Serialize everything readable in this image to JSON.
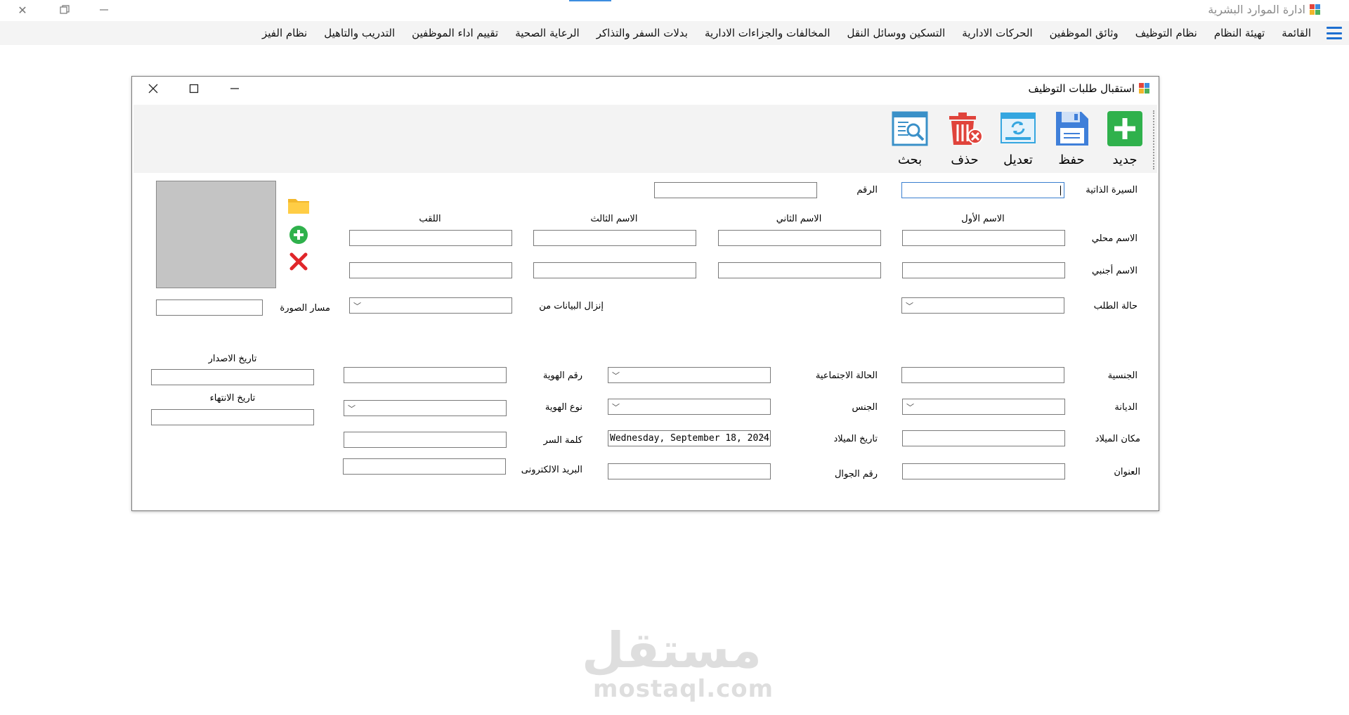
{
  "app": {
    "title": "ادارة الموارد البشرية",
    "accent_color": "#3c8de0"
  },
  "menu": {
    "icon": "hamburger-icon",
    "items": [
      {
        "label": "القائمة"
      },
      {
        "label": "تهيئة النظام"
      },
      {
        "label": "نظام التوظيف"
      },
      {
        "label": "وثائق الموظفين"
      },
      {
        "label": "الحركات الادارية"
      },
      {
        "label": "التسكين ووسائل النقل"
      },
      {
        "label": "المخالفات والجزاءات الادارية"
      },
      {
        "label": "بدلات السفر والتذاكر"
      },
      {
        "label": "الرعاية الصحية"
      },
      {
        "label": "تقييم اداء الموظفين"
      },
      {
        "label": "التدريب والتاهيل"
      },
      {
        "label": "نظام الفيز"
      }
    ]
  },
  "form": {
    "title": "استقبال طلبات التوظيف",
    "toolbar": {
      "new": {
        "label": "جديد",
        "icon": "add-icon",
        "color": "#2fb14c"
      },
      "save": {
        "label": "حفظ",
        "icon": "save-icon",
        "color": "#3f7fd9"
      },
      "edit": {
        "label": "تعديل",
        "icon": "refresh-edit-icon",
        "color": "#35a6e0"
      },
      "delete": {
        "label": "حذف",
        "icon": "trash-icon",
        "color": "#e0433b"
      },
      "search": {
        "label": "بحث",
        "icon": "search-document-icon",
        "color": "#3a90c8"
      }
    },
    "labels": {
      "cv": "السيرة الذاتية",
      "number": "الرقم",
      "first_name": "الاسم الأول",
      "second_name": "الاسم الثاني",
      "third_name": "الاسم الثالث",
      "surname": "اللقب",
      "local_name": "الاسم محلي",
      "foreign_name": "الاسم أجنبي",
      "request_status": "حالة الطلب",
      "data_source": "إنزال البيانات من",
      "image_path": "مسار الصورة",
      "nationality": "الجنسية",
      "marital_status": "الحالة الاجتماعية",
      "id_number": "رقم الهوية",
      "issue_date": "تاريخ الاصدار",
      "religion": "الديانة",
      "gender": "الجنس",
      "id_type": "نوع الهوية",
      "expiry_date": "تاريخ الانتهاء",
      "birth_place": "مكان الميلاد",
      "birth_date": "تاريخ الميلاد",
      "password": "كلمة السر",
      "address": "العنوان",
      "mobile": "رقم الجوال",
      "email": "البريد الالكترونى"
    },
    "values": {
      "birth_date": "Wednesday, September 18, 2024"
    }
  },
  "watermark": {
    "arabic": "مستقل",
    "latin": "mostaql.com"
  }
}
